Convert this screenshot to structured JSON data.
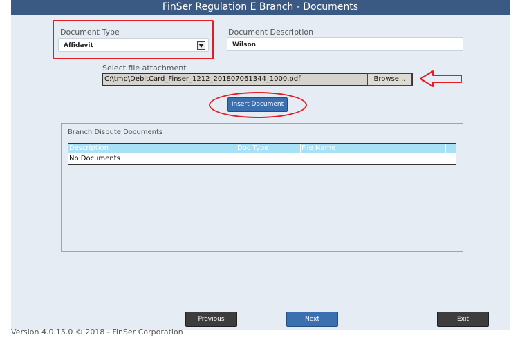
{
  "window": {
    "title": "FinSer Regulation E Branch - Documents"
  },
  "form": {
    "document_type_label": "Document Type",
    "document_type_value": "Affidavit",
    "document_description_label": "Document Description",
    "document_description_value": "Wilson",
    "file_attachment_label": "Select file attachment",
    "file_path": "C:\\tmp\\DebitCard_Finser_1212_201807061344_1000.pdf",
    "browse_label": "Browse...",
    "insert_label": "Insert Document"
  },
  "documents": {
    "group_title": "Branch Dispute Documents",
    "columns": [
      "Description",
      "Doc Type",
      "File Name"
    ],
    "empty_text": "No Documents"
  },
  "buttons": {
    "previous": "Previous",
    "next": "Next",
    "exit": "Exit"
  },
  "footer": {
    "version_text": "Version 4.0.15.0 © 2018 - FinSer Corporation"
  },
  "colors": {
    "title_bar": "#3a5a84",
    "panel": "#e6ecf3",
    "annotation_red": "#e31b23",
    "grid_header": "#a8e0f5"
  }
}
